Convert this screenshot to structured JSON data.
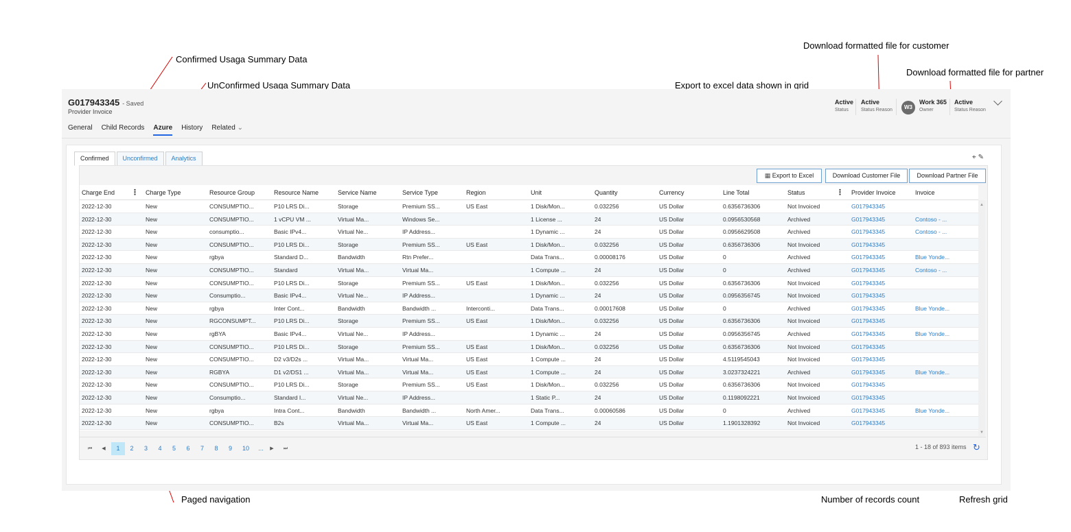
{
  "annotations": {
    "confirmed": "Confirmed Usaga Summary Data",
    "unconfirmed": "UnConfirmed Usaga Summary Data",
    "export": "Export to excel data shown in grid",
    "customer": "Download formatted file for customer",
    "partner": "Download formatted file for partner",
    "paged": "Paged navigation",
    "records": "Number of records count",
    "refresh": "Refresh grid"
  },
  "header": {
    "title": "G017943345",
    "saved": "- Saved",
    "subtitle": "Provider Invoice",
    "stat1_value": "Active",
    "stat1_label": "Status",
    "stat2_value": "Active",
    "stat2_label": "Status Reason",
    "avatar_initials": "W3",
    "owner_value": "Work 365",
    "owner_label": "Owner",
    "stat3_value": "Active",
    "stat3_label": "Status Reason"
  },
  "nav": {
    "general": "General",
    "child": "Child Records",
    "azure": "Azure",
    "history": "History",
    "related": "Related"
  },
  "subtabs": {
    "confirmed": "Confirmed",
    "unconfirmed": "Unconfirmed",
    "analytics": "Analytics"
  },
  "toolbar": {
    "export": "Export to Excel",
    "customer": "Download Customer File",
    "partner": "Download Partner File"
  },
  "columns": [
    "Charge End",
    "Charge Type",
    "Resource Group",
    "Resource Name",
    "Service Name",
    "Service Type",
    "Region",
    "Unit",
    "Quantity",
    "Currency",
    "Line Total",
    "Status",
    "Provider Invoice",
    "Invoice"
  ],
  "rows": [
    [
      "2022-12-30",
      "New",
      "CONSUMPTIO...",
      "P10 LRS Di...",
      "Storage",
      "Premium SS...",
      "US East",
      "1 Disk/Mon...",
      "0.032256",
      "US Dollar",
      "0.6356736306",
      "Not Invoiced",
      "G017943345",
      ""
    ],
    [
      "2022-12-30",
      "New",
      "CONSUMPTIO...",
      "1 vCPU VM ...",
      "Virtual Ma...",
      "Windows Se...",
      "",
      "1 License ...",
      "24",
      "US Dollar",
      "0.0956530568",
      "Archived",
      "G017943345",
      "Contoso - ..."
    ],
    [
      "2022-12-30",
      "New",
      "consumptio...",
      "Basic IPv4...",
      "Virtual Ne...",
      "IP Address...",
      "",
      "1 Dynamic ...",
      "24",
      "US Dollar",
      "0.0956629508",
      "Archived",
      "G017943345",
      "Contoso - ..."
    ],
    [
      "2022-12-30",
      "New",
      "CONSUMPTIO...",
      "P10 LRS Di...",
      "Storage",
      "Premium SS...",
      "US East",
      "1 Disk/Mon...",
      "0.032256",
      "US Dollar",
      "0.6356736306",
      "Not Invoiced",
      "G017943345",
      ""
    ],
    [
      "2022-12-30",
      "New",
      "rgbya",
      "Standard D...",
      "Bandwidth",
      "Rtn Prefer...",
      "",
      "Data Trans...",
      "0.00008176",
      "US Dollar",
      "0",
      "Archived",
      "G017943345",
      "Blue Yonde..."
    ],
    [
      "2022-12-30",
      "New",
      "CONSUMPTIO...",
      "Standard",
      "Virtual Ma...",
      "Virtual Ma...",
      "",
      "1 Compute ...",
      "24",
      "US Dollar",
      "0",
      "Archived",
      "G017943345",
      "Contoso - ..."
    ],
    [
      "2022-12-30",
      "New",
      "CONSUMPTIO...",
      "P10 LRS Di...",
      "Storage",
      "Premium SS...",
      "US East",
      "1 Disk/Mon...",
      "0.032256",
      "US Dollar",
      "0.6356736306",
      "Not Invoiced",
      "G017943345",
      ""
    ],
    [
      "2022-12-30",
      "New",
      "Consumptio...",
      "Basic IPv4...",
      "Virtual Ne...",
      "IP Address...",
      "",
      "1 Dynamic ...",
      "24",
      "US Dollar",
      "0.0956356745",
      "Not Invoiced",
      "G017943345",
      ""
    ],
    [
      "2022-12-30",
      "New",
      "rgbya",
      "Inter Cont...",
      "Bandwidth",
      "Bandwidth ...",
      "Interconti...",
      "Data Trans...",
      "0.00017608",
      "US Dollar",
      "0",
      "Archived",
      "G017943345",
      "Blue Yonde..."
    ],
    [
      "2022-12-30",
      "New",
      "RGCONSUMPT...",
      "P10 LRS Di...",
      "Storage",
      "Premium SS...",
      "US East",
      "1 Disk/Mon...",
      "0.032256",
      "US Dollar",
      "0.6356736306",
      "Not Invoiced",
      "G017943345",
      ""
    ],
    [
      "2022-12-30",
      "New",
      "rgBYA",
      "Basic IPv4...",
      "Virtual Ne...",
      "IP Address...",
      "",
      "1 Dynamic ...",
      "24",
      "US Dollar",
      "0.0956356745",
      "Archived",
      "G017943345",
      "Blue Yonde..."
    ],
    [
      "2022-12-30",
      "New",
      "CONSUMPTIO...",
      "P10 LRS Di...",
      "Storage",
      "Premium SS...",
      "US East",
      "1 Disk/Mon...",
      "0.032256",
      "US Dollar",
      "0.6356736306",
      "Not Invoiced",
      "G017943345",
      ""
    ],
    [
      "2022-12-30",
      "New",
      "CONSUMPTIO...",
      "D2 v3/D2s ...",
      "Virtual Ma...",
      "Virtual Ma...",
      "US East",
      "1 Compute ...",
      "24",
      "US Dollar",
      "4.5119545043",
      "Not Invoiced",
      "G017943345",
      ""
    ],
    [
      "2022-12-30",
      "New",
      "RGBYA",
      "D1 v2/DS1 ...",
      "Virtual Ma...",
      "Virtual Ma...",
      "US East",
      "1 Compute ...",
      "24",
      "US Dollar",
      "3.0237324221",
      "Archived",
      "G017943345",
      "Blue Yonde..."
    ],
    [
      "2022-12-30",
      "New",
      "CONSUMPTIO...",
      "P10 LRS Di...",
      "Storage",
      "Premium SS...",
      "US East",
      "1 Disk/Mon...",
      "0.032256",
      "US Dollar",
      "0.6356736306",
      "Not Invoiced",
      "G017943345",
      ""
    ],
    [
      "2022-12-30",
      "New",
      "Consumptio...",
      "Standard I...",
      "Virtual Ne...",
      "IP Address...",
      "",
      "1 Static P...",
      "24",
      "US Dollar",
      "0.1198092221",
      "Not Invoiced",
      "G017943345",
      ""
    ],
    [
      "2022-12-30",
      "New",
      "rgbya",
      "Intra Cont...",
      "Bandwidth",
      "Bandwidth ...",
      "North Amer...",
      "Data Trans...",
      "0.00060586",
      "US Dollar",
      "0",
      "Archived",
      "G017943345",
      "Blue Yonde..."
    ],
    [
      "2022-12-30",
      "New",
      "CONSUMPTIO...",
      "B2s",
      "Virtual Ma...",
      "Virtual Ma...",
      "US East",
      "1 Compute ...",
      "24",
      "US Dollar",
      "1.1901328392",
      "Not Invoiced",
      "G017943345",
      ""
    ]
  ],
  "pager": {
    "pages": [
      "1",
      "2",
      "3",
      "4",
      "5",
      "6",
      "7",
      "8",
      "9",
      "10",
      "..."
    ],
    "active": "1",
    "count": "1 - 18 of 893 items"
  },
  "colors": {
    "accent": "#2266e3",
    "link": "#2a7cc7",
    "annotation_arrow": "#e00000"
  }
}
